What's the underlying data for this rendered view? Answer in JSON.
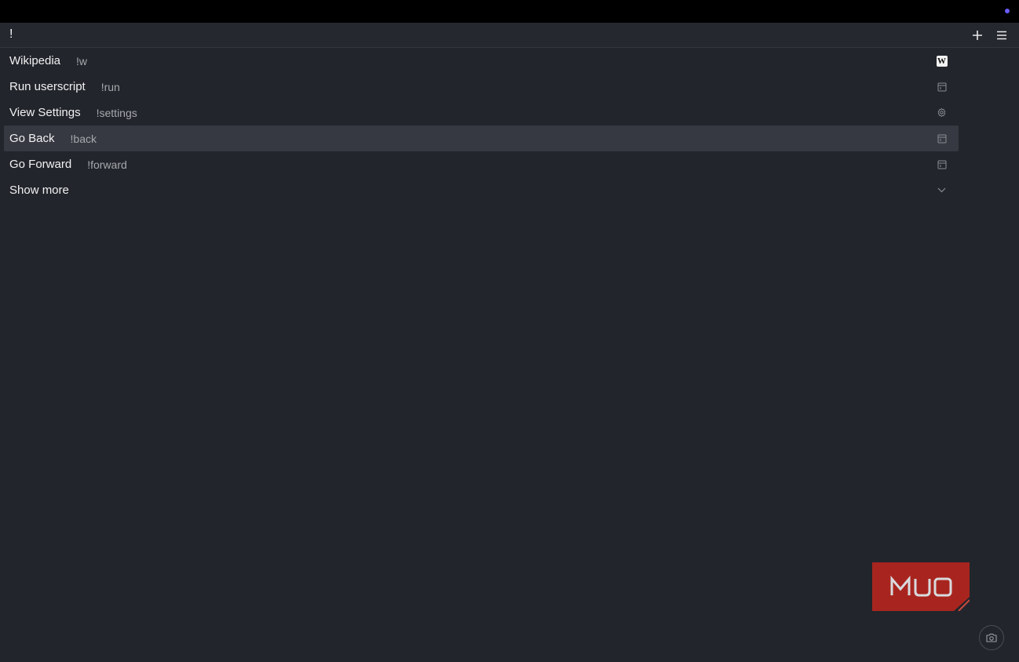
{
  "command_bar": {
    "query": "!",
    "new_tab_icon": "plus-icon",
    "menu_icon": "hamburger-menu-icon"
  },
  "results": [
    {
      "title": "Wikipedia",
      "shortcut": "!w",
      "icon": "wikipedia-icon",
      "icon_letter": "W",
      "selected": false
    },
    {
      "title": "Run userscript",
      "shortcut": "!run",
      "icon": "panel-icon",
      "selected": false
    },
    {
      "title": "View Settings",
      "shortcut": "!settings",
      "icon": "gear-icon",
      "selected": false
    },
    {
      "title": "Go Back",
      "shortcut": "!back",
      "icon": "panel-icon",
      "selected": true
    },
    {
      "title": "Go Forward",
      "shortcut": "!forward",
      "icon": "panel-icon",
      "selected": false
    }
  ],
  "show_more": {
    "label": "Show more",
    "icon": "chevron-down-icon"
  },
  "watermark": {
    "text": "MUO",
    "color": "#a8251f"
  },
  "colors": {
    "background": "#22252b",
    "selected_row": "#363941",
    "accent_dot": "#6b5cff"
  },
  "camera": {
    "icon": "camera-icon"
  }
}
